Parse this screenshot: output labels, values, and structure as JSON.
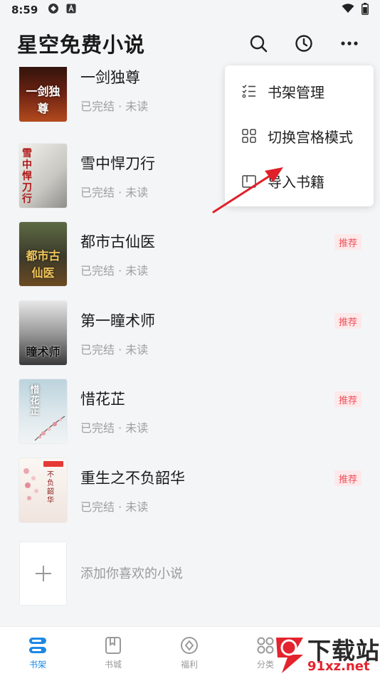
{
  "status_bar": {
    "time": "8:59"
  },
  "header": {
    "title": "星空免费小说",
    "icons": [
      "search-icon",
      "history-clock-icon",
      "more-icon"
    ]
  },
  "books": [
    {
      "title": "一剑独尊",
      "meta": "已完结 · 未读",
      "badge": "",
      "cover_text": "一剑独尊",
      "cover_colors": [
        "#3b1b10",
        "#9b3a1a"
      ]
    },
    {
      "title": "雪中悍刀行",
      "meta": "已完结 · 未读",
      "badge": "",
      "cover_text": "雪中悍刀行",
      "cover_colors": [
        "#e9e7e2",
        "#9a9a98"
      ]
    },
    {
      "title": "都市古仙医",
      "meta": "已完结 · 未读",
      "badge": "推荐",
      "cover_text": "都市古仙医",
      "cover_colors": [
        "#4d5a3a",
        "#c7a35b"
      ]
    },
    {
      "title": "第一瞳术师",
      "meta": "已完结 · 未读",
      "badge": "推荐",
      "cover_text": "瞳术师",
      "cover_colors": [
        "#d8d8d8",
        "#505050"
      ]
    },
    {
      "title": "惜花芷",
      "meta": "已完结 · 未读",
      "badge": "推荐",
      "cover_text": "惜花芷",
      "cover_colors": [
        "#c8dbe3",
        "#eef3f5"
      ]
    },
    {
      "title": "重生之不负韶华",
      "meta": "已完结 · 未读",
      "badge": "推荐",
      "cover_text": "不负韶华",
      "cover_colors": [
        "#f7f2ee",
        "#e8d7d0"
      ]
    }
  ],
  "add_book": {
    "label": "添加你喜欢的小说"
  },
  "popup_menu": {
    "items": [
      {
        "label": "书架管理",
        "icon": "list-manage-icon"
      },
      {
        "label": "切换宫格模式",
        "icon": "grid-icon"
      },
      {
        "label": "导入书籍",
        "icon": "import-icon"
      }
    ]
  },
  "tabs": [
    {
      "label": "书架",
      "icon": "bookshelf-icon",
      "active": true
    },
    {
      "label": "书城",
      "icon": "bookstore-icon",
      "active": false
    },
    {
      "label": "福利",
      "icon": "welfare-icon",
      "active": false
    },
    {
      "label": "分类",
      "icon": "category-icon",
      "active": false
    }
  ],
  "watermark": {
    "line1": "下载站",
    "line2": "91xz.net"
  },
  "colors": {
    "accent": "#1e88e5",
    "badge_bg": "#fde9ea",
    "badge_text": "#f0505a",
    "arrow": "#e0202a"
  }
}
